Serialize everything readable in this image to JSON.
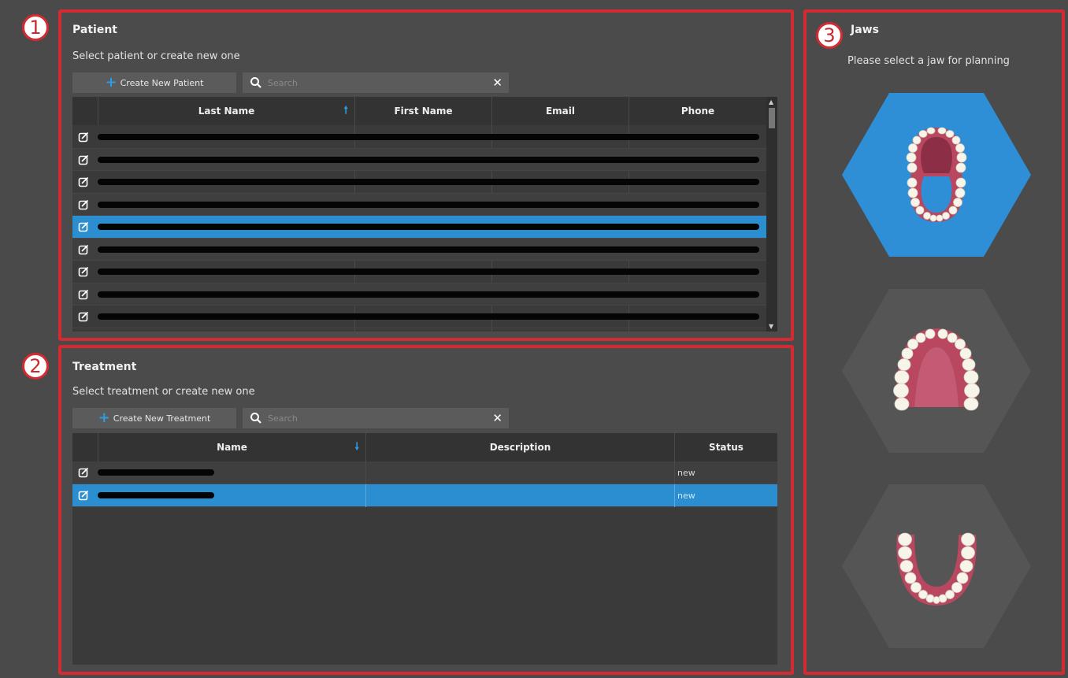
{
  "patient": {
    "badge": "1",
    "title": "Patient",
    "subtitle": "Select patient or create new one",
    "create_label": "Create New Patient",
    "search_placeholder": "Search",
    "columns": [
      "Last Name",
      "First Name",
      "Email",
      "Phone"
    ],
    "sort_column": "Last Name",
    "sort_direction": "ascending",
    "row_count_visible": 9,
    "selected_row": 5
  },
  "treatment": {
    "badge": "2",
    "title": "Treatment",
    "subtitle": "Select treatment or create new one",
    "create_label": "Create New Treatment",
    "search_placeholder": "Search",
    "columns": [
      "Name",
      "Description",
      "Status"
    ],
    "sort_column": "Name",
    "sort_direction": "descending",
    "rows": [
      {
        "status": "new",
        "selected": false
      },
      {
        "status": "new",
        "selected": true
      }
    ]
  },
  "jaws": {
    "badge": "3",
    "title": "Jaws",
    "subtitle": "Please select a jaw for planning",
    "options": [
      {
        "name": "both-jaws",
        "selected": true
      },
      {
        "name": "upper-jaw",
        "selected": false
      },
      {
        "name": "lower-jaw",
        "selected": false
      }
    ]
  },
  "colors": {
    "accent": "#2e9be0",
    "selection": "#2a8ed0",
    "highlight_border": "#d42a32",
    "gum": "#b9475f",
    "tooth": "#f7f4ea"
  }
}
